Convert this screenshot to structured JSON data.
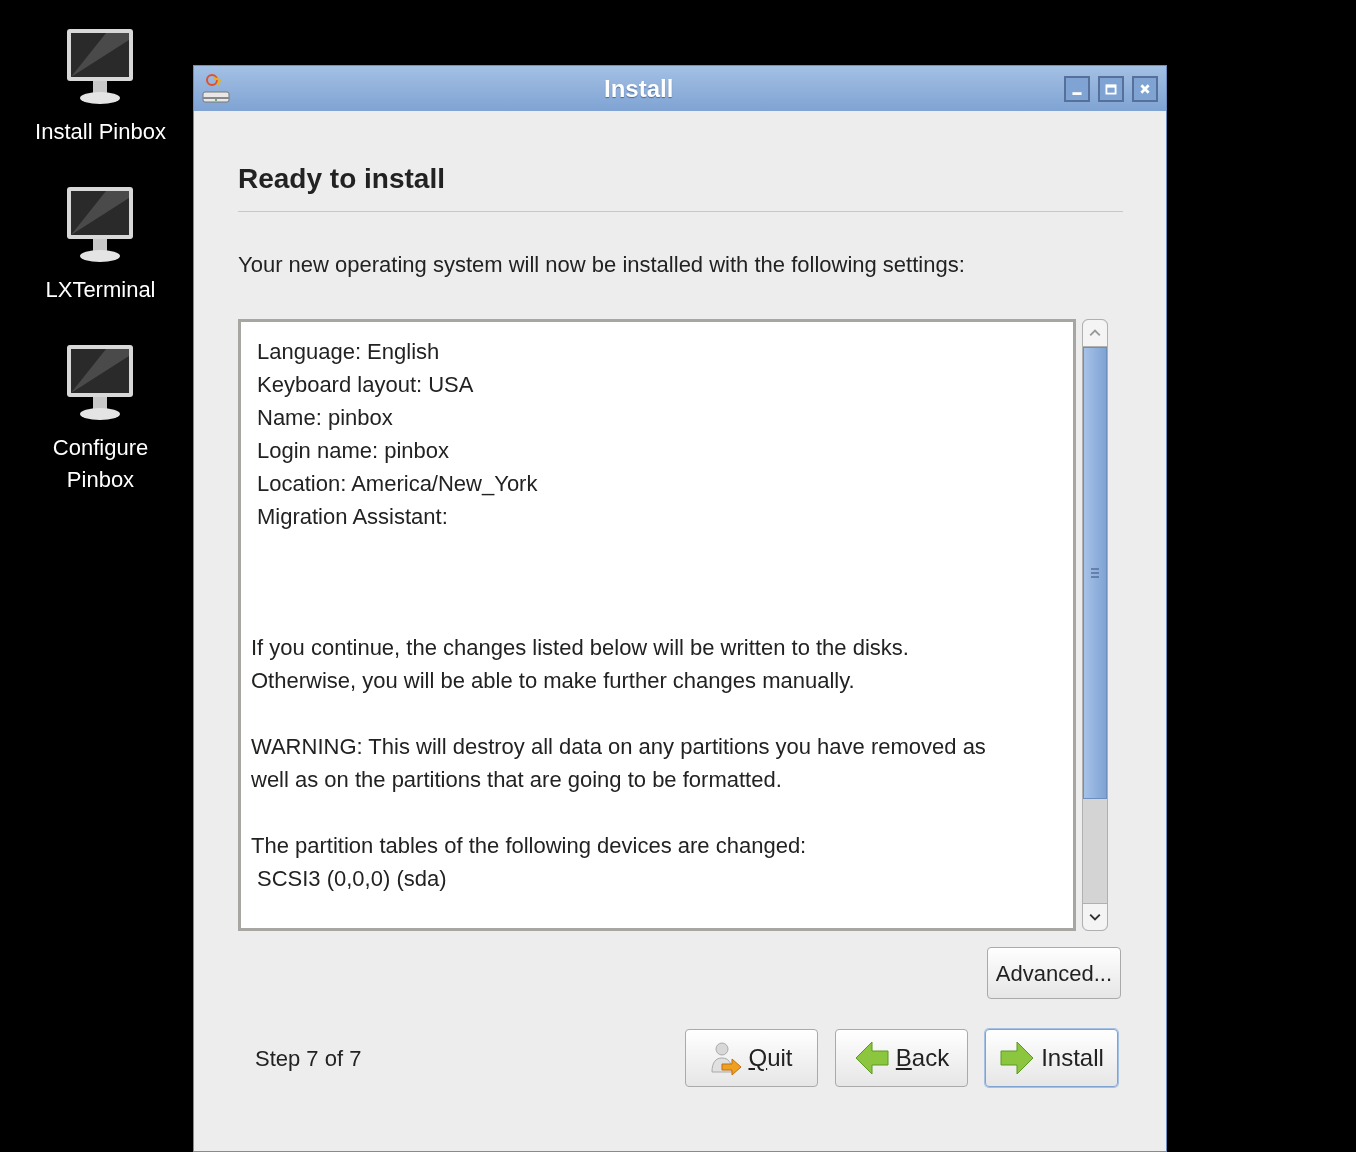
{
  "desktop_icons": [
    {
      "label": "Install Pinbox"
    },
    {
      "label": "LXTerminal"
    },
    {
      "label": "Configure\nPinbox"
    }
  ],
  "window": {
    "title": "Install",
    "controls": [
      {
        "kind": "minimize"
      },
      {
        "kind": "maximize"
      },
      {
        "kind": "close"
      }
    ]
  },
  "heading": "Ready to install",
  "intro": "Your new operating system will now be installed with the following settings:",
  "summary_box": {
    "blocks": [
      {
        "kind": "list",
        "lines": [
          "Language: English",
          "Keyboard layout: USA",
          "Name: pinbox",
          "Login name: pinbox",
          "Location: America/New_York",
          "Migration Assistant:"
        ]
      },
      {
        "kind": "paragraph",
        "text": "If you continue, the changes listed below will be written to the disks.\nOtherwise, you will be able to make further changes manually."
      },
      {
        "kind": "paragraph",
        "text": "WARNING: This will destroy all data on any partitions you have removed as\nwell as on the partitions that are going to be formatted."
      },
      {
        "kind": "paragraph",
        "text": "The partition tables of the following devices are changed:"
      },
      {
        "kind": "list",
        "lines": [
          "SCSI3 (0,0,0) (sda)"
        ]
      }
    ]
  },
  "advanced_button": "Advanced...",
  "step": "Step 7 of 7",
  "buttons": [
    {
      "kind": "quit",
      "label": "Quit",
      "mnemonic_underlined": true,
      "focused": false
    },
    {
      "kind": "back",
      "label": "Back",
      "mnemonic_underlined": true,
      "focused": false
    },
    {
      "kind": "install",
      "label": "Install",
      "focused": true
    }
  ]
}
